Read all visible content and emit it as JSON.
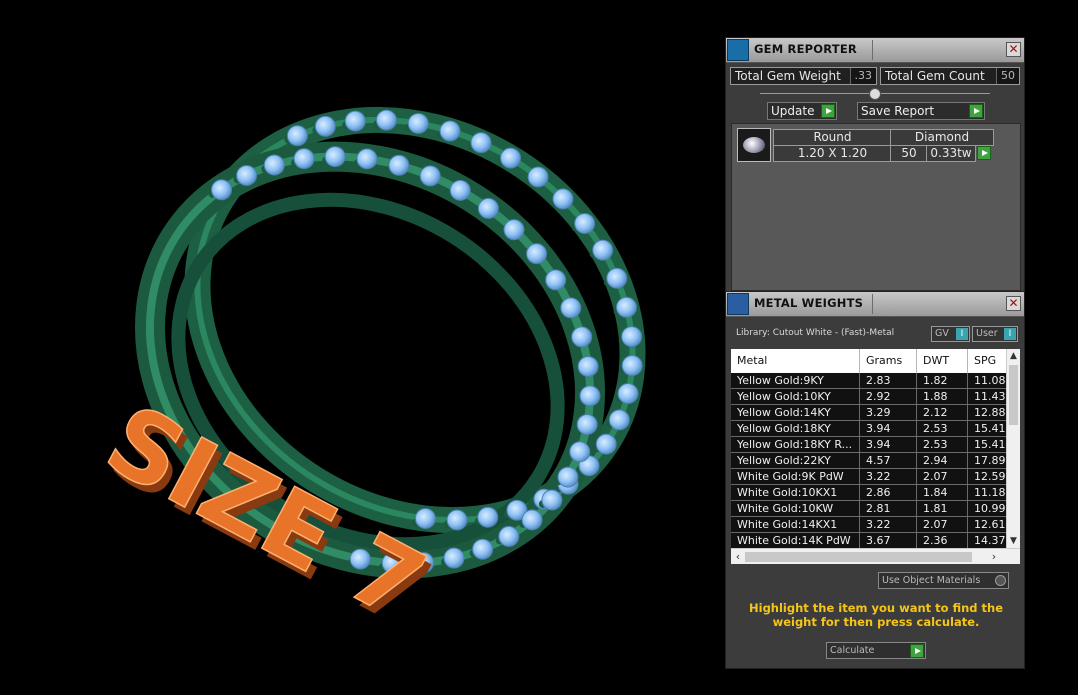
{
  "gem_reporter": {
    "title": "GEM REPORTER",
    "total_gem_weight_label": "Total Gem Weight",
    "total_gem_weight": ".33",
    "total_gem_count_label": "Total Gem Count",
    "total_gem_count": "50",
    "update_label": "Update",
    "save_report_label": "Save Report",
    "gem": {
      "shape": "Round",
      "type": "Diamond",
      "size": "1.20 X 1.20",
      "count": "50",
      "weight": "0.33tw"
    }
  },
  "metal_weights": {
    "title": "METAL WEIGHTS",
    "library": "Library: Cutout White - (Fast)-Metal",
    "gv_label": "GV",
    "gv_button": "I",
    "user_label": "User",
    "user_button": "I",
    "columns": [
      "Metal",
      "Grams",
      "DWT",
      "SPG"
    ],
    "rows": [
      {
        "metal": "Yellow Gold:9KY",
        "grams": "2.83",
        "dwt": "1.82",
        "spg": "11.08"
      },
      {
        "metal": "Yellow Gold:10KY",
        "grams": "2.92",
        "dwt": "1.88",
        "spg": "11.43"
      },
      {
        "metal": "Yellow Gold:14KY",
        "grams": "3.29",
        "dwt": "2.12",
        "spg": "12.88"
      },
      {
        "metal": "Yellow Gold:18KY",
        "grams": "3.94",
        "dwt": "2.53",
        "spg": "15.41"
      },
      {
        "metal": "Yellow Gold:18KY R...",
        "grams": "3.94",
        "dwt": "2.53",
        "spg": "15.41"
      },
      {
        "metal": "Yellow Gold:22KY",
        "grams": "4.57",
        "dwt": "2.94",
        "spg": "17.89"
      },
      {
        "metal": "White Gold:9K PdW",
        "grams": "3.22",
        "dwt": "2.07",
        "spg": "12.59"
      },
      {
        "metal": "White Gold:10KX1",
        "grams": "2.86",
        "dwt": "1.84",
        "spg": "11.18"
      },
      {
        "metal": "White Gold:10KW",
        "grams": "2.81",
        "dwt": "1.81",
        "spg": "10.99"
      },
      {
        "metal": "White Gold:14KX1",
        "grams": "3.22",
        "dwt": "2.07",
        "spg": "12.61"
      },
      {
        "metal": "White Gold:14K PdW",
        "grams": "3.67",
        "dwt": "2.36",
        "spg": "14.37"
      }
    ],
    "use_object_materials_label": "Use Object Materials",
    "hint": "Highlight the item you want to find the weight for then press calculate.",
    "calculate_label": "Calculate"
  },
  "viewport": {
    "size_text": "SIZE 7"
  },
  "colors": {
    "ring_green": "#1f6a4a",
    "gem_blue": "#8fc2f5",
    "text_orange": "#e8742a",
    "hint_yellow": "#f5c518"
  }
}
